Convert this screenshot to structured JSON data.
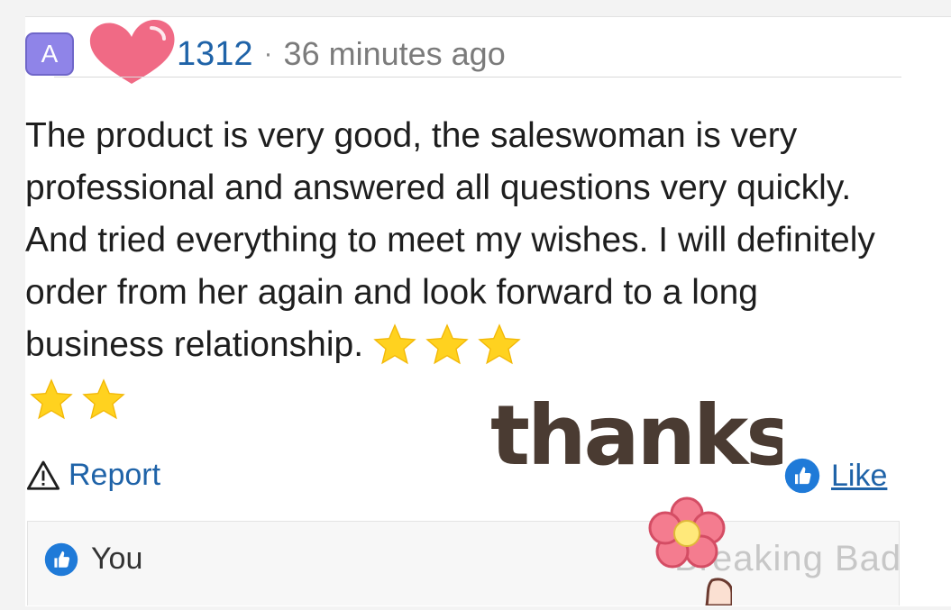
{
  "header": {
    "avatar_letter": "A",
    "username": "1312",
    "separator": "·",
    "time": "36 minutes ago"
  },
  "review": {
    "text": "The product is very good, the saleswoman is very professional and answered all questions very quickly. And tried everything to meet my wishes. I will definitely order from her again and look forward to a long business relationship.",
    "star_count": 5
  },
  "sticker": {
    "text": "thanks"
  },
  "actions": {
    "report_label": "Report",
    "like_label": "Like"
  },
  "reply": {
    "label": "You"
  },
  "watermark": {
    "text": "Breaking Bad"
  },
  "colors": {
    "avatar_bg": "#8f84e8",
    "link": "#1f63a8",
    "heart": "#f06a85",
    "star": "#ffd21f",
    "sticker": "#4a3b32",
    "thumb_bg": "#1f7ad8"
  }
}
